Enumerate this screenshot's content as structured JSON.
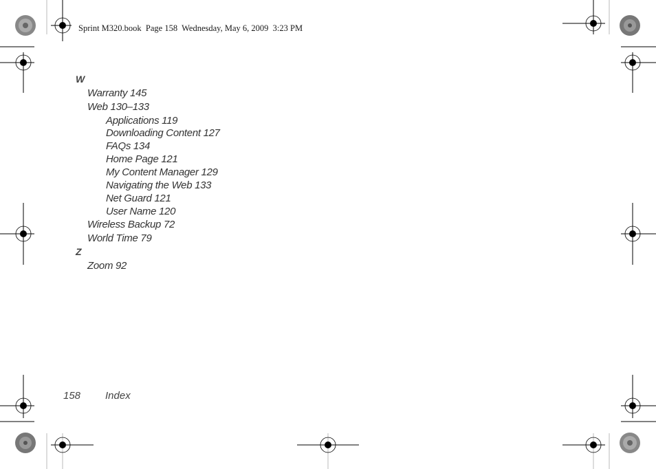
{
  "header": {
    "print_info": "Sprint M320.book  Page 158  Wednesday, May 6, 2009  3:23 PM"
  },
  "index": {
    "sections": [
      {
        "letter": "W",
        "entries": [
          {
            "text": "Warranty 145",
            "level": 1
          },
          {
            "text": "Web 130–133",
            "level": 1
          },
          {
            "text": "Applications 119",
            "level": 2
          },
          {
            "text": "Downloading Content 127",
            "level": 2
          },
          {
            "text": "FAQs 134",
            "level": 2
          },
          {
            "text": "Home Page 121",
            "level": 2
          },
          {
            "text": "My Content Manager 129",
            "level": 2
          },
          {
            "text": "Navigating the Web 133",
            "level": 2
          },
          {
            "text": "Net Guard 121",
            "level": 2
          },
          {
            "text": "User Name 120",
            "level": 2
          },
          {
            "text": "Wireless Backup 72",
            "level": 1
          },
          {
            "text": "World Time 79",
            "level": 1
          }
        ]
      },
      {
        "letter": "Z",
        "entries": [
          {
            "text": "Zoom 92",
            "level": 1
          }
        ]
      }
    ]
  },
  "footer": {
    "page_number": "158",
    "section_title": "Index"
  },
  "print_marks": {
    "registration_icon": "crosshair-registration-mark",
    "color_bar_icon": "starburst-color-target",
    "ink_color": "#000000",
    "rule_color": "#bbbbbb"
  }
}
